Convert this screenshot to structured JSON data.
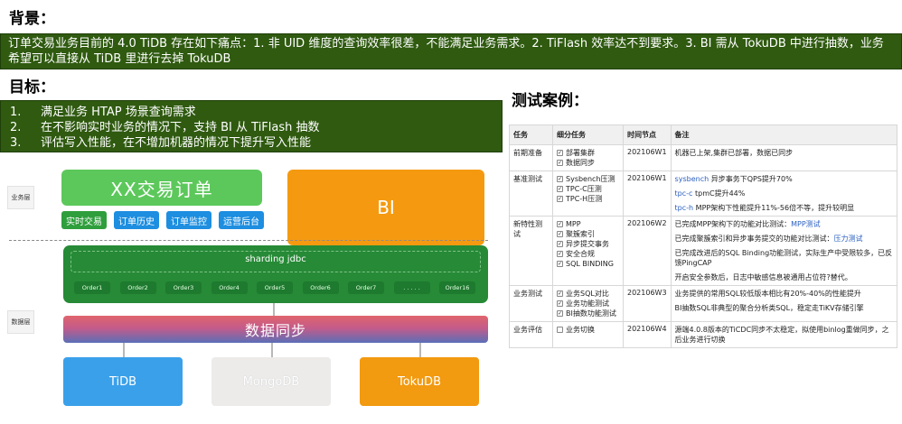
{
  "headings": {
    "background": "背景：",
    "goals": "目标：",
    "test_cases": "测试案例："
  },
  "background_text": "订单交易业务目前的 4.0 TiDB 存在如下痛点：1. 非 UID 维度的查询效率很差，不能满足业务需求。2. TiFlash 效率达不到要求。3. BI 需从 TokuDB 中进行抽数，业务希望可以直接从 TiDB 里进行去掉 TokuDB",
  "goals": [
    {
      "num": "1.",
      "text": "满足业务 HTAP 场景查询需求"
    },
    {
      "num": "2.",
      "text": "在不影响实时业务的情况下，支持 BI 从 TiFlash 抽数"
    },
    {
      "num": "3.",
      "text": "评估写入性能，在不增加机器的情况下提升写入性能"
    }
  ],
  "diagram": {
    "layer_business": "业务层",
    "layer_data": "数据层",
    "order_title": "XX交易订单",
    "bi": "BI",
    "sub_buttons": [
      "实时交易",
      "订单历史",
      "订单监控",
      "运营后台"
    ],
    "sharding_title": "sharding jdbc",
    "orders": [
      "Order1",
      "Order2",
      "Order3",
      "Order4",
      "Order5",
      "Order6",
      "Order7",
      ". . . . .",
      "Order16"
    ],
    "sync": "数据同步",
    "dbs": [
      "TiDB",
      "MongoDB",
      "TokuDB"
    ]
  },
  "table": {
    "headers": [
      "任务",
      "细分任务",
      "时间节点",
      "备注"
    ],
    "rows": [
      {
        "task": "前期准备",
        "subtasks": [
          "部署集群",
          "数据同步"
        ],
        "date": "202106W1",
        "notes": [
          {
            "parts": [
              {
                "t": "机器已上架,集群已部署，数据已同步"
              }
            ]
          }
        ]
      },
      {
        "task": "基准测试",
        "subtasks": [
          "Sysbench压测",
          "TPC-C压测",
          "TPC-H压测"
        ],
        "date": "202106W1",
        "notes": [
          {
            "parts": [
              {
                "t": "sysbench",
                "link": true
              },
              {
                "t": " 异步事务下QPS提升70%"
              }
            ]
          },
          {
            "parts": [
              {
                "t": "tpc-c",
                "link": true
              },
              {
                "t": " tpmC提升44%"
              }
            ]
          },
          {
            "parts": [
              {
                "t": "tpc-h",
                "link": true
              },
              {
                "t": " MPP架构下性能提升11%-56倍不等，提升较明显"
              }
            ]
          }
        ]
      },
      {
        "task": "新特性测试",
        "subtasks": [
          "MPP",
          "聚簇索引",
          "异步提交事务",
          "安全合规",
          "SQL BINDING"
        ],
        "date": "202106W2",
        "notes": [
          {
            "parts": [
              {
                "t": "已完成MPP架构下的功能对比测试："
              },
              {
                "t": "MPP测试",
                "link": true
              }
            ]
          },
          {
            "parts": [
              {
                "t": "已完成聚簇索引和异步事务提交的功能对比测试："
              },
              {
                "t": "压力测试",
                "link": true
              }
            ]
          },
          {
            "parts": [
              {
                "t": "已完成改进后的SQL Binding功能测试，实际生产中受限较多，已反馈PingCAP"
              }
            ]
          },
          {
            "parts": [
              {
                "t": "开启安全参数后，日志中敏感信息被通用占位符?替代。"
              }
            ]
          }
        ]
      },
      {
        "task": "业务测试",
        "subtasks": [
          "业务SQL对比",
          "业务功能测试",
          "BI抽数功能测试"
        ],
        "date": "202106W3",
        "notes": [
          {
            "parts": [
              {
                "t": "业务提供的常用SQL较低版本相比有20%-40%的性能提升"
              }
            ]
          },
          {
            "parts": [
              {
                "t": "BI抽数SQL非典型的聚合分析类SQL，稳定走TiKV存储引擎"
              }
            ]
          }
        ]
      },
      {
        "task": "业务评估",
        "subtasks": [
          "业务切换"
        ],
        "unchecked": true,
        "date": "202106W4",
        "notes": [
          {
            "parts": [
              {
                "t": "源端4.0.8版本的TiCDC同步不太稳定，拟使用binlog重做同步，之后业务进行切换"
              }
            ]
          }
        ]
      }
    ]
  }
}
